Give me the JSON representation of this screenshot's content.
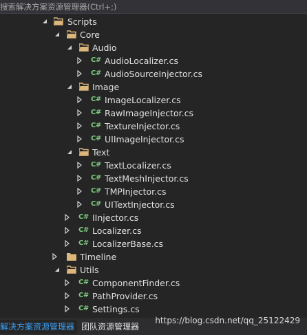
{
  "search": {
    "placeholder": "搜索解决方案资源管理器(Ctrl+;)"
  },
  "tree": {
    "scripts": "Scripts",
    "core": "Core",
    "audio": "Audio",
    "audio_localizer": "AudioLocalizer.cs",
    "audio_source_injector": "AudioSourceInjector.cs",
    "image": "Image",
    "image_localizer": "ImageLocalizer.cs",
    "raw_image_injector": "RawImageInjector.cs",
    "texture_injector": "TextureInjector.cs",
    "ui_image_injector": "UIImageInjector.cs",
    "text": "Text",
    "text_localizer": "TextLocalizer.cs",
    "text_mesh_injector": "TextMeshInjector.cs",
    "tmp_injector": "TMPInjector.cs",
    "ui_text_injector": "UITextInjector.cs",
    "iinjector": "IInjector.cs",
    "localizer": "Localizer.cs",
    "localizer_base": "LocalizerBase.cs",
    "timeline": "Timeline",
    "utils": "Utils",
    "component_finder": "ComponentFinder.cs",
    "path_provider": "PathProvider.cs",
    "settings": "Settings.cs",
    "cs_badge": "C#"
  },
  "watermark": "https://blog.csdn.net/qq_25122429",
  "tabs": {
    "solution_explorer": "解决方案资源管理器",
    "team_explorer": "团队资源管理器"
  },
  "colors": {
    "background": "#252526",
    "folder": "#dcb67a",
    "cs_icon": "#7dc97d",
    "active_tab": "#3aa0f3"
  }
}
